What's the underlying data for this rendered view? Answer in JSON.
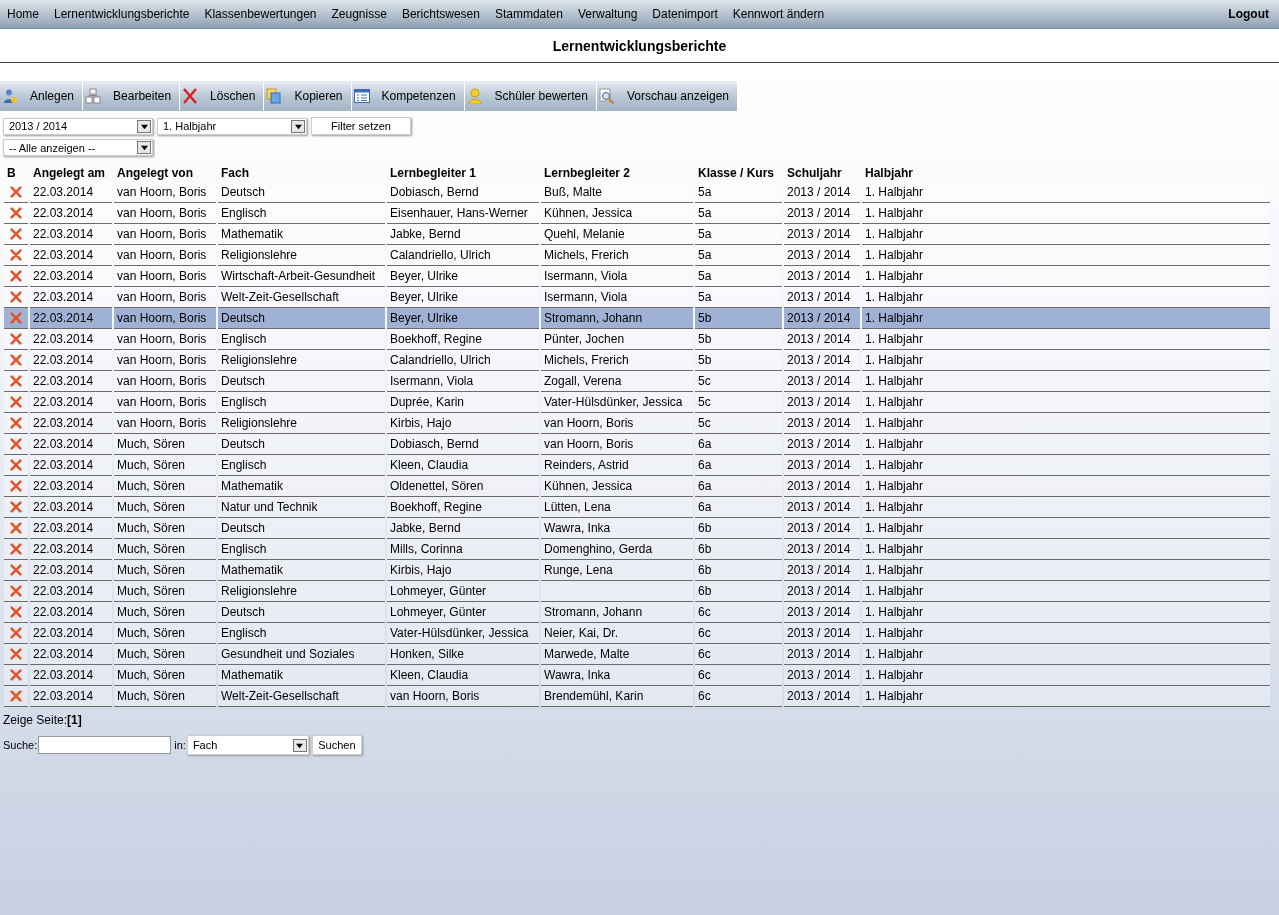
{
  "menu": {
    "items": [
      {
        "label": "Home"
      },
      {
        "label": "Lernentwicklungsberichte"
      },
      {
        "label": "Klassenbewertungen"
      },
      {
        "label": "Zeugnisse"
      },
      {
        "label": "Berichtswesen"
      },
      {
        "label": "Stammdaten"
      },
      {
        "label": "Verwaltung"
      },
      {
        "label": "Datenimport"
      },
      {
        "label": "Kennwort ändern"
      }
    ],
    "logout": "Logout"
  },
  "page_title": "Lernentwicklungsberichte",
  "toolbar": [
    {
      "kind": "add",
      "label": "Anlegen"
    },
    {
      "kind": "edit",
      "label": "Bearbeiten"
    },
    {
      "kind": "delete",
      "label": "Löschen"
    },
    {
      "kind": "copy",
      "label": "Kopieren"
    },
    {
      "kind": "list",
      "label": "Kompetenzen"
    },
    {
      "kind": "user",
      "label": "Schüler bewerten"
    },
    {
      "kind": "preview",
      "label": "Vorschau anzeigen"
    }
  ],
  "filters": {
    "year": "2013 / 2014",
    "term": "1. Halbjahr",
    "apply_button": "Filter setzen",
    "show": "-- Alle anzeigen --"
  },
  "table": {
    "columns": [
      "B",
      "Angelegt am",
      "Angelegt von",
      "Fach",
      "Lernbegleiter 1",
      "Lernbegleiter 2",
      "Klasse / Kurs",
      "Schuljahr",
      "Halbjahr"
    ],
    "rows": [
      {
        "selected": false,
        "cells": [
          "",
          "22.03.2014",
          "van Hoorn, Boris",
          "Deutsch",
          "Dobiasch, Bernd",
          "Buß, Malte",
          "5a",
          "2013 / 2014",
          "1. Halbjahr"
        ]
      },
      {
        "selected": false,
        "cells": [
          "",
          "22.03.2014",
          "van Hoorn, Boris",
          "Englisch",
          "Eisenhauer, Hans-Werner",
          "Kühnen, Jessica",
          "5a",
          "2013 / 2014",
          "1. Halbjahr"
        ]
      },
      {
        "selected": false,
        "cells": [
          "",
          "22.03.2014",
          "van Hoorn, Boris",
          "Mathematik",
          "Jabke, Bernd",
          "Quehl, Melanie",
          "5a",
          "2013 / 2014",
          "1. Halbjahr"
        ]
      },
      {
        "selected": false,
        "cells": [
          "",
          "22.03.2014",
          "van Hoorn, Boris",
          "Religionslehre",
          "Calandriello, Ulrich",
          "Michels, Frerich",
          "5a",
          "2013 / 2014",
          "1. Halbjahr"
        ]
      },
      {
        "selected": false,
        "cells": [
          "",
          "22.03.2014",
          "van Hoorn, Boris",
          "Wirtschaft-Arbeit-Gesundheit",
          "Beyer, Ulrike",
          "Isermann, Viola",
          "5a",
          "2013 / 2014",
          "1. Halbjahr"
        ]
      },
      {
        "selected": false,
        "cells": [
          "",
          "22.03.2014",
          "van Hoorn, Boris",
          "Welt-Zeit-Gesellschaft",
          "Beyer, Ulrike",
          "Isermann, Viola",
          "5a",
          "2013 / 2014",
          "1. Halbjahr"
        ]
      },
      {
        "selected": true,
        "cells": [
          "",
          "22.03.2014",
          "van Hoorn, Boris",
          "Deutsch",
          "Beyer, Ulrike",
          "Stromann, Johann",
          "5b",
          "2013 / 2014",
          "1. Halbjahr"
        ]
      },
      {
        "selected": false,
        "cells": [
          "",
          "22.03.2014",
          "van Hoorn, Boris",
          "Englisch",
          "Boekhoff, Regine",
          "Pünter, Jochen",
          "5b",
          "2013 / 2014",
          "1. Halbjahr"
        ]
      },
      {
        "selected": false,
        "cells": [
          "",
          "22.03.2014",
          "van Hoorn, Boris",
          "Religionslehre",
          "Calandriello, Ulrich",
          "Michels, Frerich",
          "5b",
          "2013 / 2014",
          "1. Halbjahr"
        ]
      },
      {
        "selected": false,
        "cells": [
          "",
          "22.03.2014",
          "van Hoorn, Boris",
          "Deutsch",
          "Isermann, Viola",
          "Zogall, Verena",
          "5c",
          "2013 / 2014",
          "1. Halbjahr"
        ]
      },
      {
        "selected": false,
        "cells": [
          "",
          "22.03.2014",
          "van Hoorn, Boris",
          "Englisch",
          "Duprée, Karin",
          "Vater-Hülsdünker, Jessica",
          "5c",
          "2013 / 2014",
          "1. Halbjahr"
        ]
      },
      {
        "selected": false,
        "cells": [
          "",
          "22.03.2014",
          "van Hoorn, Boris",
          "Religionslehre",
          "Kirbis, Hajo",
          "van Hoorn, Boris",
          "5c",
          "2013 / 2014",
          "1. Halbjahr"
        ]
      },
      {
        "selected": false,
        "cells": [
          "",
          "22.03.2014",
          "Much, Sören",
          "Deutsch",
          "Dobiasch, Bernd",
          "van Hoorn, Boris",
          "6a",
          "2013 / 2014",
          "1. Halbjahr"
        ]
      },
      {
        "selected": false,
        "cells": [
          "",
          "22.03.2014",
          "Much, Sören",
          "Englisch",
          "Kleen, Claudia",
          "Reinders, Astrid",
          "6a",
          "2013 / 2014",
          "1. Halbjahr"
        ]
      },
      {
        "selected": false,
        "cells": [
          "",
          "22.03.2014",
          "Much, Sören",
          "Mathematik",
          "Oldenettel, Sören",
          "Kühnen, Jessica",
          "6a",
          "2013 / 2014",
          "1. Halbjahr"
        ]
      },
      {
        "selected": false,
        "cells": [
          "",
          "22.03.2014",
          "Much, Sören",
          "Natur und Technik",
          "Boekhoff, Regine",
          "Lütten, Lena",
          "6a",
          "2013 / 2014",
          "1. Halbjahr"
        ]
      },
      {
        "selected": false,
        "cells": [
          "",
          "22.03.2014",
          "Much, Sören",
          "Deutsch",
          "Jabke, Bernd",
          "Wawra, Inka",
          "6b",
          "2013 / 2014",
          "1. Halbjahr"
        ]
      },
      {
        "selected": false,
        "cells": [
          "",
          "22.03.2014",
          "Much, Sören",
          "Englisch",
          "Mills, Corinna",
          "Domenghino, Gerda",
          "6b",
          "2013 / 2014",
          "1. Halbjahr"
        ]
      },
      {
        "selected": false,
        "cells": [
          "",
          "22.03.2014",
          "Much, Sören",
          "Mathematik",
          "Kirbis, Hajo",
          "Runge, Lena",
          "6b",
          "2013 / 2014",
          "1. Halbjahr"
        ]
      },
      {
        "selected": false,
        "cells": [
          "",
          "22.03.2014",
          "Much, Sören",
          "Religionslehre",
          "Lohmeyer, Günter",
          null,
          "6b",
          "2013 / 2014",
          "1. Halbjahr"
        ]
      },
      {
        "selected": false,
        "cells": [
          "",
          "22.03.2014",
          "Much, Sören",
          "Deutsch",
          "Lohmeyer, Günter",
          "Stromann, Johann",
          "6c",
          "2013 / 2014",
          "1. Halbjahr"
        ]
      },
      {
        "selected": false,
        "cells": [
          "",
          "22.03.2014",
          "Much, Sören",
          "Englisch",
          "Vater-Hülsdünker, Jessica",
          "Neier, Kai, Dr.",
          "6c",
          "2013 / 2014",
          "1. Halbjahr"
        ]
      },
      {
        "selected": false,
        "cells": [
          "",
          "22.03.2014",
          "Much, Sören",
          "Gesundheit und Soziales",
          "Honken, Silke",
          "Marwede, Malte",
          "6c",
          "2013 / 2014",
          "1. Halbjahr"
        ]
      },
      {
        "selected": false,
        "cells": [
          "",
          "22.03.2014",
          "Much, Sören",
          "Mathematik",
          "Kleen, Claudia",
          "Wawra, Inka",
          "6c",
          "2013 / 2014",
          "1. Halbjahr"
        ]
      },
      {
        "selected": false,
        "cells": [
          "",
          "22.03.2014",
          "Much, Sören",
          "Welt-Zeit-Gesellschaft",
          "van Hoorn, Boris",
          "Brendemühl, Karin",
          "6c",
          "2013 / 2014",
          "1. Halbjahr"
        ]
      }
    ]
  },
  "pager": {
    "label": "Zeige Seite:",
    "current": "[1]"
  },
  "search": {
    "label": "Suche:",
    "in_label": "in:",
    "field": "Fach",
    "button": "Suchen"
  }
}
